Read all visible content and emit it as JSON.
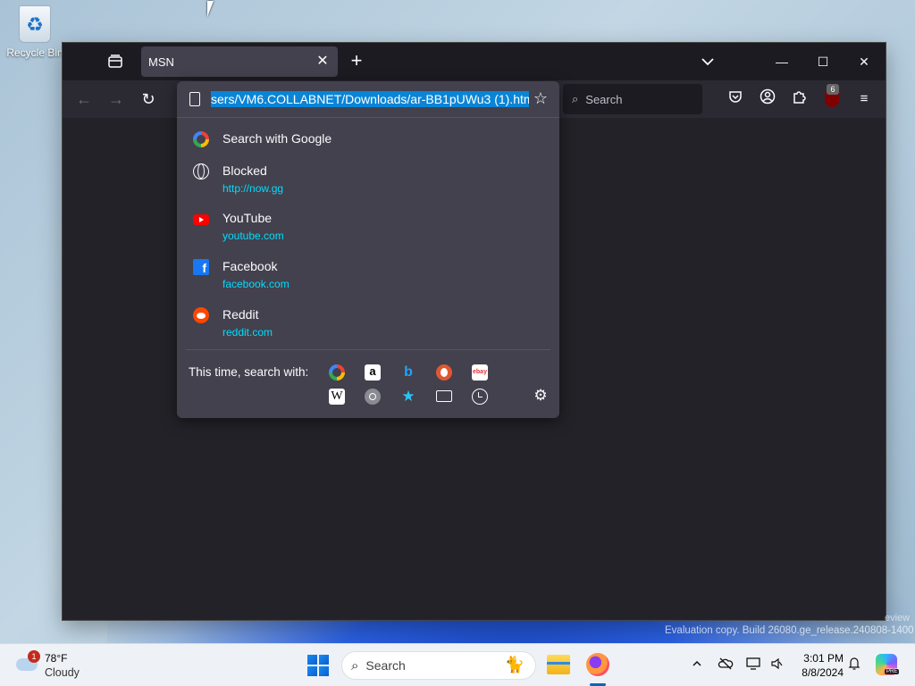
{
  "desktop": {
    "recycle_bin_label": "Recycle Bin"
  },
  "browser": {
    "tab": {
      "title": "MSN",
      "close_glyph": "✕"
    },
    "new_tab_glyph": "+",
    "window_controls": {
      "minimize": "—",
      "maximize": "☐",
      "close": "✕"
    },
    "nav": {
      "back": "←",
      "forward": "→",
      "reload": "↻"
    },
    "urlbar": {
      "url_text": "sers/VM6.COLLABNET/Downloads/ar-BB1pUWu3 (1).htm",
      "star_glyph": "☆"
    },
    "search": {
      "placeholder": "Search",
      "glyph": "⌕"
    },
    "toolbar": {
      "ublock_count": "6",
      "menu_glyph": "≡"
    }
  },
  "dropdown": {
    "results": [
      {
        "title": "Search with Google",
        "url": "",
        "icon": "google-icon"
      },
      {
        "title": "Blocked",
        "url": "http://now.gg",
        "icon": "globe-icon"
      },
      {
        "title": "YouTube",
        "url": "youtube.com",
        "icon": "youtube-icon"
      },
      {
        "title": "Facebook",
        "url": "facebook.com",
        "icon": "facebook-icon"
      },
      {
        "title": "Reddit",
        "url": "reddit.com",
        "icon": "reddit-icon"
      }
    ],
    "oneoff_label": "This time, search with:",
    "engines": [
      "google",
      "amazon",
      "bing",
      "duckduckgo",
      "ebay",
      "wikipedia",
      "lookup",
      "bookmarks",
      "tabs",
      "history",
      "settings"
    ]
  },
  "watermark": {
    "text": "Evaluation copy. Build 26080.ge_release.240808-1400",
    "preview_fragment": "eview"
  },
  "taskbar": {
    "weather": {
      "temp": "78°F",
      "condition": "Cloudy",
      "badge": "1"
    },
    "search_placeholder": "Search",
    "clock": {
      "time": "3:01 PM",
      "date": "8/8/2024"
    },
    "copilot_badge": "PRE"
  },
  "colors": {
    "accent_selection": "#0a84d6",
    "link": "#00ddff",
    "panel": "#42414d",
    "toolbar": "#2b2a33",
    "tabstrip": "#1c1b22"
  }
}
